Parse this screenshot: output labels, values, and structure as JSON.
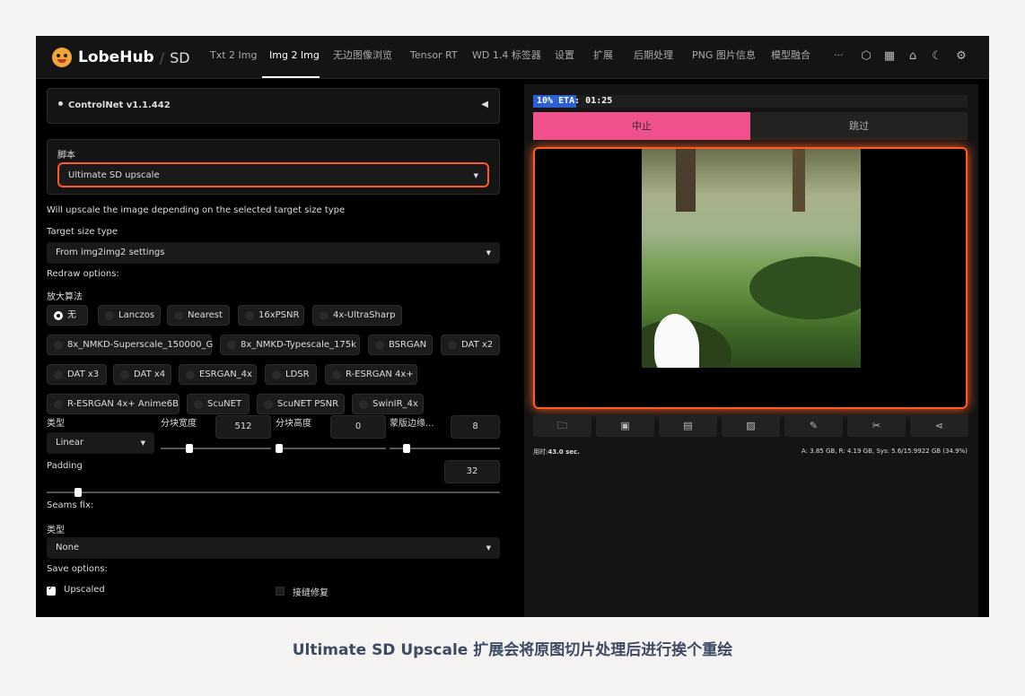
{
  "nav": {
    "brand": "LobeHub",
    "separator": "/",
    "product": "SD",
    "tabs": [
      "Txt 2 Img",
      "Img 2 Img",
      "无边图像浏览",
      "Tensor RT",
      "WD 1.4 标签器",
      "设置",
      "扩展",
      "后期处理",
      "PNG 图片信息",
      "模型融合"
    ],
    "active_tab": "Img 2 Img",
    "more": "···",
    "icons": [
      "hexagon-icon",
      "grid-icon",
      "github-icon",
      "moon-icon",
      "settings-icon"
    ]
  },
  "left": {
    "controlnet_label": "ControlNet v1.1.442",
    "collapse_glyph": "◀",
    "script_label": "脚本",
    "script_value": "Ultimate SD upscale",
    "description": "Will upscale the image depending on the selected target size type",
    "target_size_label": "Target size type",
    "target_size_value": "From img2img2 settings",
    "redraw_label": "Redraw options:",
    "upscaler_label": "放大算法",
    "upscalers": [
      "无",
      "Lanczos",
      "Nearest",
      "16xPSNR",
      "4x-UltraSharp",
      "8x_NMKD-Superscale_150000_G",
      "8x_NMKD-Typescale_175k",
      "BSRGAN",
      "DAT x2",
      "DAT x3",
      "DAT x4",
      "ESRGAN_4x",
      "LDSR",
      "R-ESRGAN 4x+",
      "R-ESRGAN 4x+ Anime6B",
      "ScuNET",
      "ScuNET PSNR",
      "SwinIR_4x"
    ],
    "selected_upscaler": "无",
    "type_label": "类型",
    "type_value": "Linear",
    "tile_width_label": "分块宽度",
    "tile_width_value": "512",
    "tile_height_label": "分块高度",
    "tile_height_value": "0",
    "mask_blur_label": "蒙版边缘...",
    "mask_blur_value": "8",
    "padding_label": "Padding",
    "padding_value": "32",
    "seams_label": "Seams fix:",
    "seams_type_label": "类型",
    "seams_type_value": "None",
    "save_label": "Save options:",
    "upscaled_label": "Upscaled",
    "upscaled_checked": true,
    "seams_fix_label": "接缝修复",
    "seams_fix_checked": false
  },
  "right": {
    "progress_text": "10% ETA: 01:25",
    "progress_fraction": 0.1,
    "stop_label": "中止",
    "skip_label": "跳过",
    "tools": [
      "folder-icon",
      "save-icon",
      "zip-icon",
      "image-icon",
      "brush-icon",
      "tools-icon",
      "share-icon"
    ],
    "time_label": "用时:",
    "time_value": "43.0 sec.",
    "memory": "A: 3.85 GB, R: 4.19 GB, Sys: 5.6/15.9922 GB (34.9%)"
  },
  "caption": "Ultimate SD Upscale 扩展会将原图切片处理后进行挨个重绘",
  "colors": {
    "accent_pink": "#f0508c",
    "highlight_orange": "#ff5a1f",
    "progress_blue": "#2c5fd1"
  }
}
